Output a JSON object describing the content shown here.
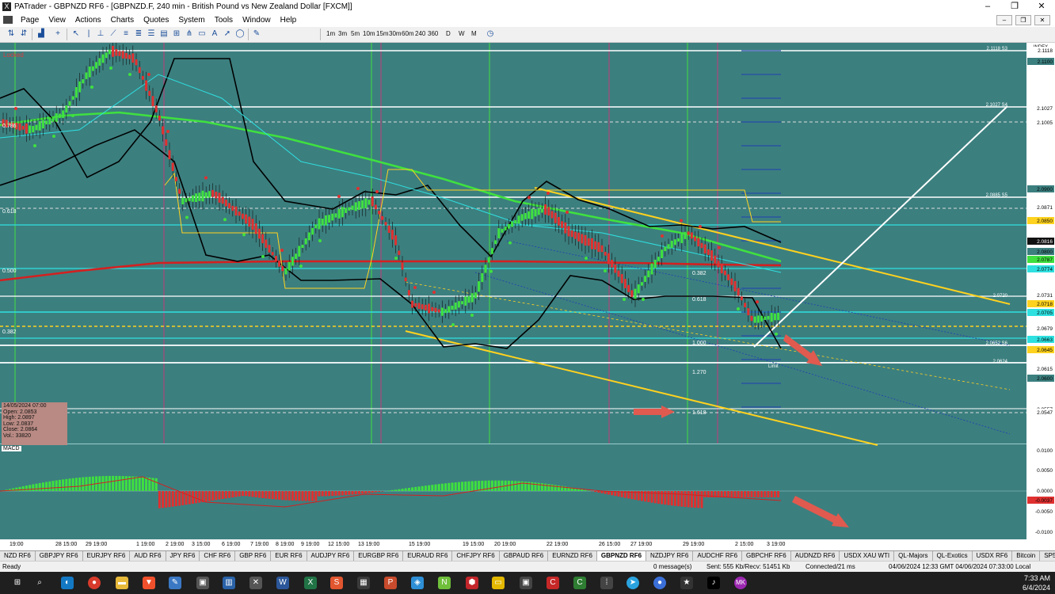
{
  "window": {
    "app_title": "PATrader - GBPNZD RF6 - [GBPNZD.F, 240 min - British Pound vs New Zealand Dollar [FXCM]]",
    "controls": [
      "–",
      "❐",
      "✕"
    ]
  },
  "menu": {
    "items": [
      "Page",
      "View",
      "Actions",
      "Charts",
      "Quotes",
      "System",
      "Tools",
      "Window",
      "Help"
    ]
  },
  "toolbar": {
    "timeframes": [
      "1m",
      "3m",
      "5m",
      "10m",
      "15m",
      "30m",
      "60m",
      "240",
      "360",
      "D",
      "W",
      "M"
    ]
  },
  "chart": {
    "locked_label": "Locked",
    "indicator_label": "MACD",
    "price_labels": [
      {
        "v": "2.1118",
        "c": "#ffffff",
        "t": "#000000"
      },
      {
        "v": "2.1100",
        "c": "#3c7f7f",
        "t": "#000000"
      },
      {
        "v": "2.1027",
        "c": "#ffffff",
        "t": "#000000"
      },
      {
        "v": "2.1005",
        "c": "#ffffff",
        "t": "#000000"
      },
      {
        "v": "2.0900",
        "c": "#3c7f7f",
        "t": "#000000"
      },
      {
        "v": "2.0871",
        "c": "#ffffff",
        "t": "#000000"
      },
      {
        "v": "2.0850",
        "c": "#ffd21f",
        "t": "#000000"
      },
      {
        "v": "2.0816",
        "c": "#111111",
        "t": "#ffffff"
      },
      {
        "v": "2.0800",
        "c": "#3c7f7f",
        "t": "#000000"
      },
      {
        "v": "2.0787",
        "c": "#3fe03f",
        "t": "#000000"
      },
      {
        "v": "2.0774",
        "c": "#2fe0e0",
        "t": "#000000"
      },
      {
        "v": "2.0731",
        "c": "#ffffff",
        "t": "#000000"
      },
      {
        "v": "2.0718",
        "c": "#ffd21f",
        "t": "#000000"
      },
      {
        "v": "2.0705",
        "c": "#2fe0e0",
        "t": "#000000"
      },
      {
        "v": "2.0679",
        "c": "#ffffff",
        "t": "#000000"
      },
      {
        "v": "2.0663",
        "c": "#2fe0e0",
        "t": "#000000"
      },
      {
        "v": "2.0645",
        "c": "#ffd21f",
        "t": "#000000"
      },
      {
        "v": "2.0615",
        "c": "#ffffff",
        "t": "#000000"
      },
      {
        "v": "2.0600",
        "c": "#3c7f7f",
        "t": "#000000"
      },
      {
        "v": "2.0557",
        "c": "#ffffff",
        "t": "#000000"
      },
      {
        "v": "2.0547",
        "c": "#ffffff",
        "t": "#000000"
      }
    ],
    "macd_labels": [
      "0.0100",
      "0.0050",
      "0.0000",
      "-0.0037",
      "-0.0050",
      "-0.0100"
    ],
    "level_labels_left": [
      "0.786",
      "0.618",
      "0.500",
      "0.382"
    ],
    "level_labels_right": [
      "2.1118 S3",
      "2.1027 S4",
      "2.0885 S5",
      "2.0720",
      "2.0652 S6",
      "2.0624"
    ],
    "fib_labels": [
      "0.382",
      "0.618",
      "1.000",
      "1.270",
      "1.618"
    ],
    "time_labels": [
      "19:00",
      "28 15:00",
      "29 19:00",
      "1 19:00",
      "2 19:00",
      "3 15:00",
      "6 19:00",
      "7 19:00",
      "8 19:00",
      "9 19:00",
      "12 15:00",
      "13 19:00",
      "15 19:00",
      "19 15:00",
      "20 19:00",
      "22 19:00",
      "26 15:00",
      "27 19:00",
      "29 19:00",
      "2 15:00",
      "3 19:00"
    ],
    "ohlc": {
      "date": "14/05/2024 07:00",
      "open": "Open: 2.0853",
      "high": "High: 2.0897",
      "low": "Low: 2.0837",
      "close": "Close: 2.0864",
      "vol": "Vol.: 33820"
    },
    "index_label": "INDEX",
    "limit_label": "Limit"
  },
  "symbol_tabs": [
    "NZD RF6",
    "GBPJPY RF6",
    "EURJPY RF6",
    "AUD RF6",
    "JPY RF6",
    "CHF RF6",
    "GBP RF6",
    "EUR RF6",
    "AUDJPY RF6",
    "EURGBP RF6",
    "EURAUD RF6",
    "CHFJPY RF6",
    "GBPAUD RF6",
    "EURNZD RF6",
    "GBPNZD RF6",
    "NZDJPY RF6",
    "AUDCHF RF6",
    "GBPCHF RF6",
    "AUDNZD RF6",
    "USDX XAU WTI",
    "QL-Majors",
    "QL-Exotics",
    "USDX RF6",
    "Bitcoin",
    "SP500",
    "DJIA"
  ],
  "active_tab": "GBPNZD RF6",
  "status": {
    "ready": "Ready",
    "messages": "0 message(s)",
    "traffic": "Sent: 555 Kb/Recv: 51451 Kb",
    "connection": "Connected/21 ms",
    "times": "04/06/2024 12:33 GMT  04/06/2024 07:33:00 Local"
  },
  "taskbar": {
    "clock_time": "7:33 AM",
    "clock_date": "6/4/2024",
    "apps": [
      "windows-icon",
      "search-icon",
      "outlook-icon",
      "chrome-icon",
      "explorer-icon",
      "brave-icon",
      "notepad-icon",
      "word-icon",
      "excel-icon",
      "powerpoint-icon",
      "tradingview-icon",
      "telegram-icon",
      "tiktok-icon"
    ]
  }
}
